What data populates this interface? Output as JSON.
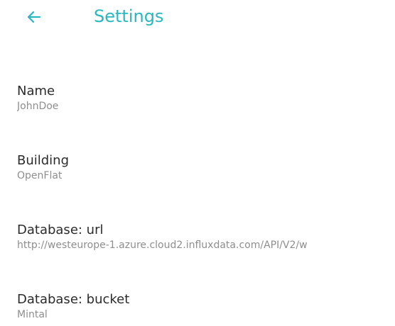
{
  "header": {
    "title": "Settings",
    "back_icon": "arrow-left-icon",
    "accent_color": "#2ab7c0"
  },
  "settings": {
    "items": [
      {
        "title": "Name",
        "value": "JohnDoe"
      },
      {
        "title": "Building",
        "value": "OpenFlat"
      },
      {
        "title": "Database: url",
        "value": "http://westeurope-1.azure.cloud2.influxdata.com/API/V2/w"
      },
      {
        "title": "Database: bucket",
        "value": "Mintal"
      }
    ]
  }
}
